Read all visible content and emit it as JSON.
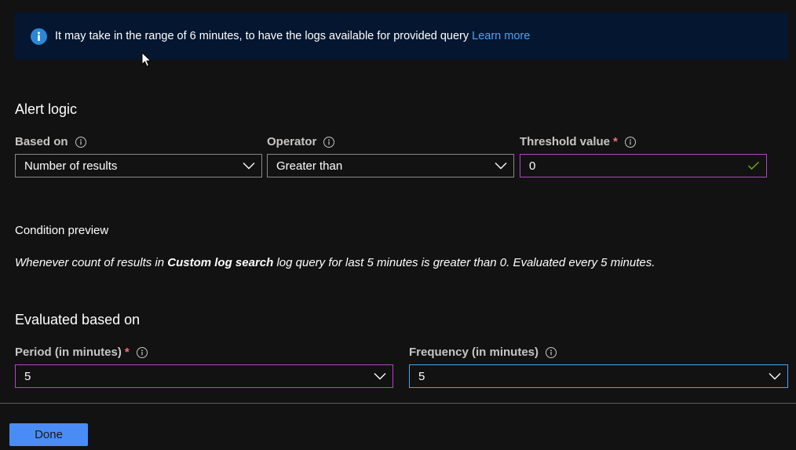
{
  "banner": {
    "icon": "info-icon",
    "message": "It may take in the range of 6 minutes, to have the logs available for provided query",
    "link_text": "Learn more"
  },
  "alert_logic": {
    "title": "Alert logic",
    "based_on": {
      "label": "Based on",
      "value": "Number of results"
    },
    "operator": {
      "label": "Operator",
      "value": "Greater than"
    },
    "threshold": {
      "label": "Threshold value",
      "required_mark": "*",
      "value": "0"
    }
  },
  "condition_preview": {
    "label": "Condition preview",
    "text_before": "Whenever count of results in ",
    "query_name": "Custom log search",
    "text_after": " log query for last 5 minutes is greater than 0. Evaluated every 5 minutes."
  },
  "evaluated": {
    "title": "Evaluated based on",
    "period": {
      "label": "Period (in minutes)",
      "required_mark": "*",
      "value": "5"
    },
    "frequency": {
      "label": "Frequency (in minutes)",
      "value": "5"
    }
  },
  "footer": {
    "done_label": "Done"
  },
  "colors": {
    "background": "#121212",
    "banner_bg": "#041630",
    "accent": "#4a8cf5",
    "link": "#4aa3f0",
    "focus_purple": "#b146c2",
    "required": "#f1707b",
    "success": "#6bb700"
  }
}
